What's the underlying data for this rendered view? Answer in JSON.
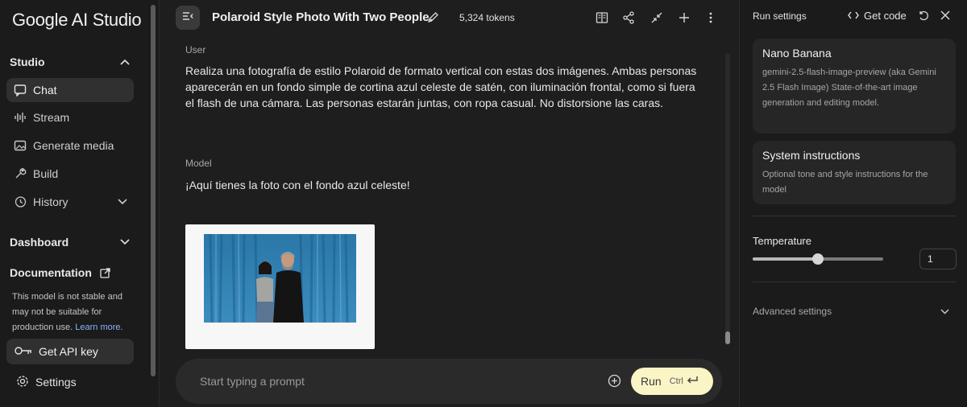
{
  "sidebar": {
    "logo": "Google AI Studio",
    "studio_label": "Studio",
    "items": [
      {
        "label": "Chat",
        "icon": "chat-icon"
      },
      {
        "label": "Stream",
        "icon": "stream-icon"
      },
      {
        "label": "Generate media",
        "icon": "media-icon"
      },
      {
        "label": "Build",
        "icon": "build-icon"
      },
      {
        "label": "History",
        "icon": "history-icon"
      }
    ],
    "dashboard_label": "Dashboard",
    "documentation_label": "Documentation",
    "note_text": "This model is not stable and may not be suitable for production use.",
    "note_link": "Learn more.",
    "api_key_label": "Get API key",
    "settings_label": "Settings"
  },
  "header": {
    "title": "Polaroid Style Photo With Two People.",
    "tokens": "5,324 tokens"
  },
  "chat": {
    "user_role": "User",
    "user_message": "Realiza una fotografía de estilo Polaroid de formato vertical con estas dos imágenes. Ambas personas aparecerán en un fondo simple de cortina azul celeste de satén, con iluminación frontal, como si fuera el flash de una cámara. Las personas estarán juntas, con ropa casual. No distorsione las caras.",
    "model_role": "Model",
    "model_message": "¡Aquí tienes la foto con el fondo azul celeste!"
  },
  "prompt": {
    "placeholder": "Start typing a prompt",
    "run_label": "Run",
    "shortcut": "Ctrl"
  },
  "run_settings": {
    "title": "Run settings",
    "get_code_label": "Get code",
    "model_name": "Nano Banana",
    "model_description": "gemini-2.5-flash-image-preview (aka Gemini 2.5 Flash Image) State-of-the-art image generation and editing model.",
    "system_title": "System instructions",
    "system_description": "Optional tone and style instructions for the model",
    "temperature_label": "Temperature",
    "temperature_value": "1",
    "temperature_fraction": 0.5,
    "advanced_label": "Advanced settings"
  },
  "colors": {
    "run_button": "#fbf5c6",
    "link": "#8ab4f8",
    "curtain": "#2f7fb0"
  }
}
